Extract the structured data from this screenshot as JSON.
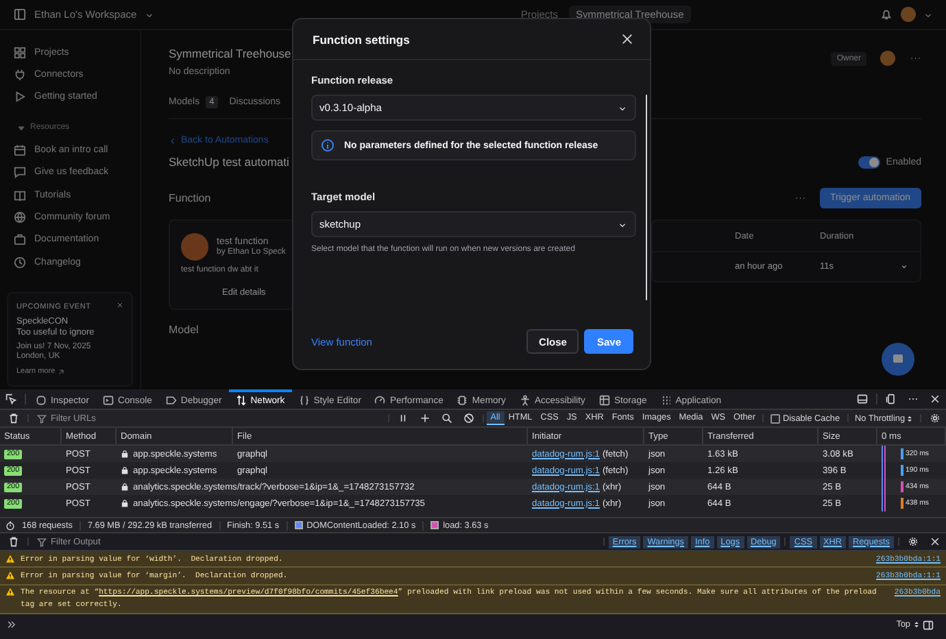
{
  "app": {
    "topbar": {
      "workspace": "Ethan Lo's Workspace",
      "breadcrumb": [
        "Projects",
        "Symmetrical Treehouse"
      ]
    },
    "sidebar": {
      "items": [
        {
          "label": "Projects"
        },
        {
          "label": "Connectors"
        },
        {
          "label": "Getting started"
        }
      ],
      "resources": {
        "label": "Resources",
        "expanded": true,
        "items": [
          {
            "label": "Book an intro call"
          },
          {
            "label": "Give us feedback"
          },
          {
            "label": "Tutorials"
          },
          {
            "label": "Community forum"
          },
          {
            "label": "Documentation"
          },
          {
            "label": "Changelog"
          }
        ]
      },
      "event": {
        "eyebrow": "UPCOMING EVENT",
        "title": "SpeckleCON",
        "subtitle": "Too useful to ignore",
        "date": "Join us! 7 Nov, 2025",
        "location": "London, UK",
        "link": "Learn more"
      }
    },
    "project": {
      "title": "Symmetrical Treehouse",
      "description": "No description",
      "role": "Owner",
      "tabs": [
        {
          "label": "Models",
          "count": "4",
          "selected": false
        },
        {
          "label": "Discussions",
          "selected": false
        }
      ]
    },
    "back_link": "Back to Automations",
    "automation": {
      "title": "SketchUp test automati",
      "enabled": true,
      "enabled_label": "Enabled"
    },
    "function_section": {
      "heading": "Function",
      "trigger_button": "Trigger automation",
      "card": {
        "name": "test function",
        "author": "by Ethan Lo Speck",
        "description": "test function dw abt it",
        "edit_button": "Edit details"
      }
    },
    "runs": {
      "columns": [
        "Date",
        "Duration"
      ],
      "rows": [
        {
          "date": "an hour ago",
          "duration": "11s"
        }
      ]
    },
    "model_heading": "Model"
  },
  "modal": {
    "title": "Function settings",
    "release_label": "Function release",
    "release_value": "v0.3.10-alpha",
    "info": "No parameters defined for the selected function release",
    "target_label": "Target model",
    "target_value": "sketchup",
    "target_hint": "Select model that the function will run on when new versions are created",
    "view_link": "View function",
    "close_button": "Close",
    "save_button": "Save"
  },
  "devtools": {
    "tabs": [
      {
        "label": "Inspector",
        "selected": false
      },
      {
        "label": "Console",
        "selected": false
      },
      {
        "label": "Debugger",
        "selected": false
      },
      {
        "label": "Network",
        "selected": true
      },
      {
        "label": "Style Editor",
        "selected": false
      },
      {
        "label": "Performance",
        "selected": false
      },
      {
        "label": "Memory",
        "selected": false
      },
      {
        "label": "Accessibility",
        "selected": false
      },
      {
        "label": "Storage",
        "selected": false
      },
      {
        "label": "Application",
        "selected": false
      }
    ],
    "network": {
      "filter_placeholder": "Filter URLs",
      "types": [
        {
          "label": "All",
          "selected": true
        },
        {
          "label": "HTML",
          "selected": false
        },
        {
          "label": "CSS",
          "selected": false
        },
        {
          "label": "JS",
          "selected": false
        },
        {
          "label": "XHR",
          "selected": false
        },
        {
          "label": "Fonts",
          "selected": false
        },
        {
          "label": "Images",
          "selected": false
        },
        {
          "label": "Media",
          "selected": false
        },
        {
          "label": "WS",
          "selected": false
        },
        {
          "label": "Other",
          "selected": false
        }
      ],
      "disable_cache": {
        "label": "Disable Cache",
        "checked": false
      },
      "throttling": "No Throttling",
      "columns": [
        "Status",
        "Method",
        "Domain",
        "File",
        "Initiator",
        "Type",
        "Transferred",
        "Size",
        "0 ms"
      ],
      "rows": [
        {
          "status": "200",
          "method": "POST",
          "domain": "app.speckle.systems",
          "file": "graphql",
          "initiator": "datadog-rum.js:1",
          "initiator_kind": "(fetch)",
          "type": "json",
          "transferred": "1.63 kB",
          "size": "3.08 kB",
          "timing": "320 ms",
          "color": "#4a9ff2",
          "selected": false
        },
        {
          "status": "200",
          "method": "POST",
          "domain": "app.speckle.systems",
          "file": "graphql",
          "initiator": "datadog-rum.js:1",
          "initiator_kind": "(fetch)",
          "type": "json",
          "transferred": "1.26 kB",
          "size": "396 B",
          "timing": "190 ms",
          "color": "#4a9ff2",
          "selected": false
        },
        {
          "status": "200",
          "method": "POST",
          "domain": "analytics.speckle.systems",
          "file": "/track/?verbose=1&ip=1&_=1748273157732",
          "initiator": "datadog-rum.js:1",
          "initiator_kind": "(xhr)",
          "type": "json",
          "transferred": "644 B",
          "size": "25 B",
          "timing": "434 ms",
          "color": "#d64fb8",
          "selected": false
        },
        {
          "status": "200",
          "method": "POST",
          "domain": "analytics.speckle.systems",
          "file": "/engage/?verbose=1&ip=1&_=1748273157735",
          "initiator": "datadog-rum.js:1",
          "initiator_kind": "(xhr)",
          "type": "json",
          "transferred": "644 B",
          "size": "25 B",
          "timing": "438 ms",
          "color": "#e07b2a",
          "selected": false
        }
      ],
      "summary": {
        "requests": "168 requests",
        "transferred": "7.69 MB / 292.29 kB transferred",
        "finish": "Finish: 9.51 s",
        "dom": "DOMContentLoaded: 2.10 s",
        "load": "load: 3.63 s"
      }
    },
    "console": {
      "filter_placeholder": "Filter Output",
      "levels": [
        {
          "label": "Errors",
          "selected": true
        },
        {
          "label": "Warnings",
          "selected": true
        },
        {
          "label": "Info",
          "selected": true
        },
        {
          "label": "Logs",
          "selected": true
        },
        {
          "label": "Debug",
          "selected": true
        }
      ],
      "categories": [
        {
          "label": "CSS",
          "selected": true
        },
        {
          "label": "XHR",
          "selected": true
        },
        {
          "label": "Requests",
          "selected": true
        }
      ],
      "messages": [
        {
          "text": "Error in parsing value for ‘width’.  Declaration dropped.",
          "source": "263b3b0bda:1:1"
        },
        {
          "text": "Error in parsing value for ‘margin’.  Declaration dropped.",
          "source": "263b3b0bda:1:1"
        },
        {
          "text": "The resource at “",
          "link": "https://app.speckle.systems/preview/d7f0f98bfo/commits/45ef36bee4",
          "text_after": "” preloaded with link preload was not used within a few seconds. Make sure all attributes of the preload tag are set correctly.",
          "source": "263b3b0bda"
        }
      ],
      "context": "Top"
    }
  }
}
